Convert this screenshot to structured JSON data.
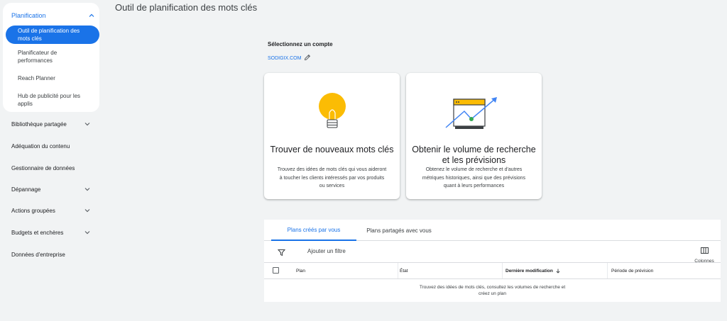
{
  "page_title": "Outil de planification des mots clés",
  "sidebar": {
    "group_label": "Planification",
    "sub_items": [
      {
        "label": "Outil de planification des mots clés",
        "active": true
      },
      {
        "label": "Planificateur de performances"
      },
      {
        "label": "Reach Planner"
      },
      {
        "label": "Hub de publicité pour les applis"
      }
    ],
    "items": [
      {
        "label": "Bibliothèque partagée",
        "expandable": true
      },
      {
        "label": "Adéquation du contenu",
        "expandable": false
      },
      {
        "label": "Gestionnaire de données",
        "expandable": false
      },
      {
        "label": "Dépannage",
        "expandable": true
      },
      {
        "label": "Actions groupées",
        "expandable": true
      },
      {
        "label": "Budgets et enchères",
        "expandable": true
      },
      {
        "label": "Données d'entreprise",
        "expandable": false
      }
    ]
  },
  "account": {
    "label": "Sélectionnez un compte",
    "value": "SODIGIX.COM",
    "edit_icon": "pencil-icon"
  },
  "cards": [
    {
      "icon": "lightbulb-icon",
      "title": "Trouver de nouveaux mots clés",
      "description": "Trouvez des idées de mots clés qui vous aideront à toucher les clients intéressés par vos produits ou services"
    },
    {
      "icon": "trend-chart-icon",
      "title": "Obtenir le volume de recherche et les prévisions",
      "description": "Obtenez le volume de recherche et d'autres métriques historiques, ainsi que des prévisions quant à leurs performances"
    }
  ],
  "plans": {
    "tabs": [
      "Plans créés par vous",
      "Plans partagés avec vous"
    ],
    "active_tab": 0,
    "filter_label": "Ajouter un filtre",
    "columns_label": "Colonnes",
    "headers": [
      "Plan",
      "État",
      "Dernière modification",
      "Période de prévision"
    ],
    "empty_message_line1": "Trouvez des idées de mots clés, consultez les volumes de recherche et",
    "empty_message_line2": "créez un plan"
  },
  "colors": {
    "accent": "#1a73e8",
    "background": "#f1f3f4",
    "bulb": "#fbbc04",
    "chart_line": "#4285f4",
    "chart_dot": "#34a853"
  }
}
